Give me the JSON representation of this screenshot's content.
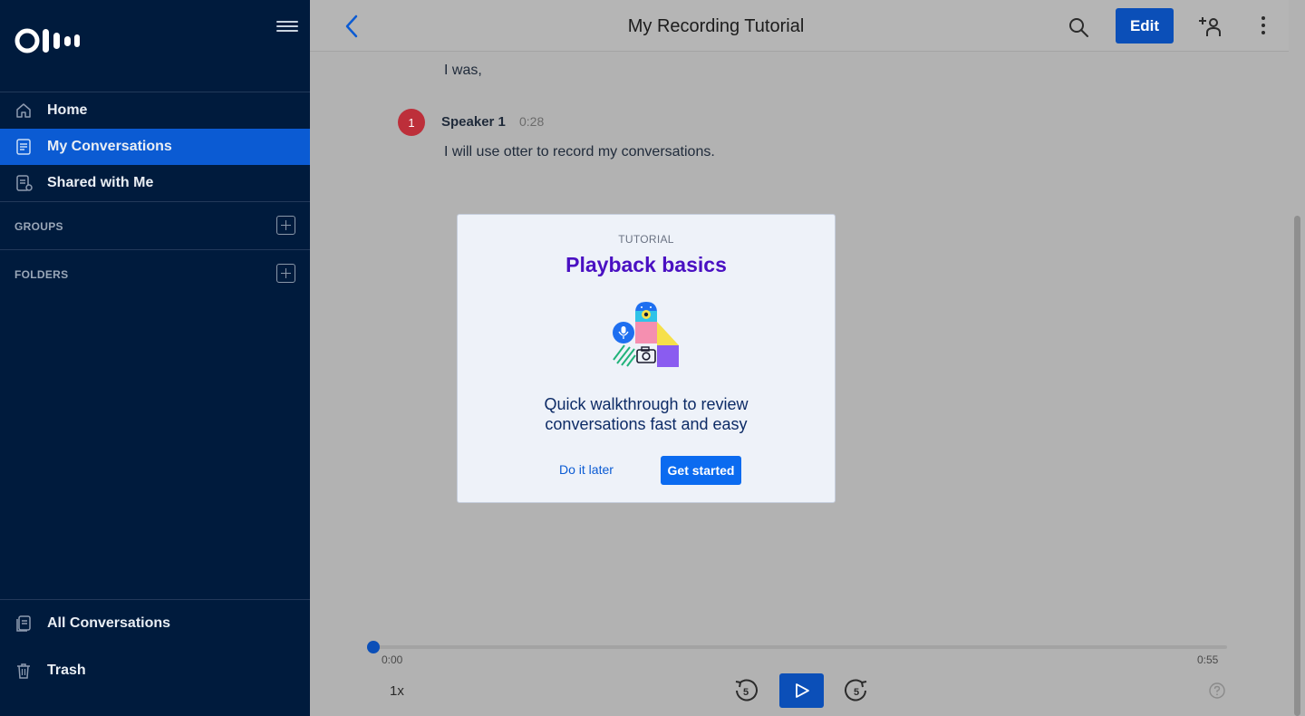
{
  "sidebar": {
    "nav": [
      {
        "label": "Home",
        "icon": "home-icon"
      },
      {
        "label": "My Conversations",
        "icon": "conversations-icon",
        "active": true
      },
      {
        "label": "Shared with Me",
        "icon": "shared-icon"
      }
    ],
    "groups_label": "GROUPS",
    "folders_label": "FOLDERS",
    "bottom": [
      {
        "label": "All Conversations",
        "icon": "all-conversations-icon"
      },
      {
        "label": "Trash",
        "icon": "trash-icon"
      }
    ]
  },
  "header": {
    "title": "My Recording Tutorial",
    "edit_label": "Edit"
  },
  "transcript": {
    "prev_line": "I was,",
    "speaker_badge": "1",
    "speaker_name": "Speaker 1",
    "speaker_time": "0:28",
    "line": "I will use otter to record my conversations."
  },
  "modal": {
    "eyebrow": "TUTORIAL",
    "title": "Playback basics",
    "description": "Quick walkthrough to review conversations fast and easy",
    "later_label": "Do it later",
    "start_label": "Get started"
  },
  "player": {
    "time_start": "0:00",
    "time_end": "0:55",
    "speed": "1x",
    "rewind_seconds": "5",
    "forward_seconds": "5",
    "progress": 0
  },
  "colors": {
    "sidebar_bg": "#001b3d",
    "active_item": "#0b5bd3",
    "primary_button": "#0b4fb8",
    "modal_title": "#4a10c2"
  }
}
